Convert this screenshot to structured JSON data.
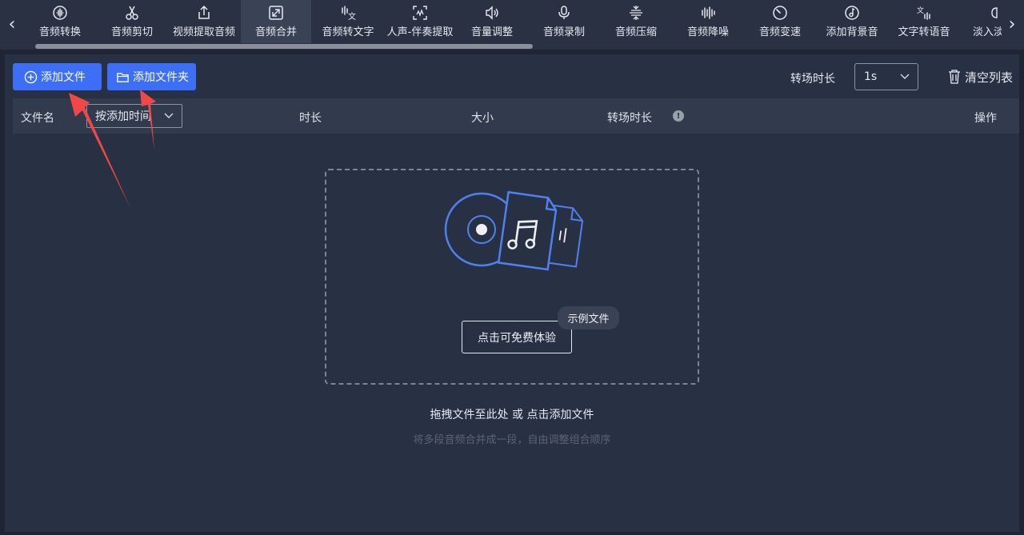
{
  "toolbar": {
    "tools": [
      {
        "label": "音频转换",
        "icon": "audio-wave-icon"
      },
      {
        "label": "音频剪切",
        "icon": "scissors-icon"
      },
      {
        "label": "视频提取音频",
        "icon": "export-icon"
      },
      {
        "label": "音频合并",
        "icon": "merge-icon",
        "active": true
      },
      {
        "label": "音频转文字",
        "icon": "speech-to-text-icon"
      },
      {
        "label": "人声-伴奏提取",
        "icon": "vocal-extract-icon"
      },
      {
        "label": "音量调整",
        "icon": "volume-icon"
      },
      {
        "label": "音频录制",
        "icon": "microphone-icon"
      },
      {
        "label": "音频压缩",
        "icon": "compress-icon"
      },
      {
        "label": "音频降噪",
        "icon": "denoise-icon"
      },
      {
        "label": "音频变速",
        "icon": "speed-icon"
      },
      {
        "label": "添加背景音",
        "icon": "music-note-icon"
      },
      {
        "label": "文字转语音",
        "icon": "text-to-speech-icon"
      },
      {
        "label": "淡入淡",
        "icon": "fade-icon"
      }
    ],
    "prev_arrow": "‹",
    "next_arrow": "›"
  },
  "actions": {
    "add_file": "添加文件",
    "add_folder": "添加文件夹",
    "transition_label": "转场时长",
    "transition_value": "1s",
    "clear_list": "清空列表"
  },
  "table": {
    "col_filename": "文件名",
    "sort_select": "按添加时间",
    "col_duration": "时长",
    "col_size": "大小",
    "col_transition": "转场时长",
    "info_mark": "!",
    "col_actions": "操作"
  },
  "dropzone": {
    "try_button": "点击可免费体验",
    "example_tag": "示例文件",
    "hint": "拖拽文件至此处 或 点击添加文件",
    "subhint": "将多段音频合并成一段，自由调整组合顺序"
  },
  "colors": {
    "accent": "#3c6ff5",
    "background": "#1f2535",
    "panel": "#283043",
    "arrow_annotation": "#f04848"
  }
}
